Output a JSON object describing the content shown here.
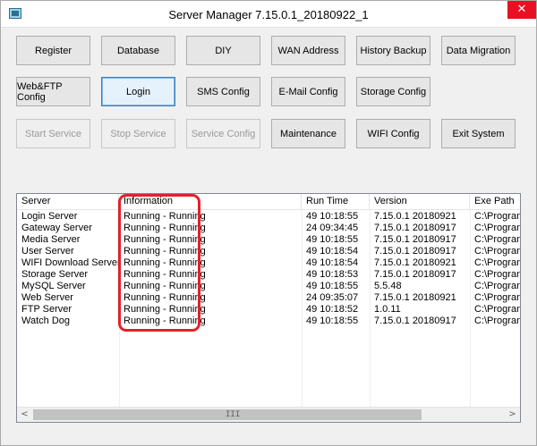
{
  "window": {
    "title": "Server Manager 7.15.0.1_20180922_1",
    "close_glyph": "✕",
    "icon": "app-icon"
  },
  "buttons": {
    "row1": [
      "Register",
      "Database",
      "DIY",
      "WAN Address",
      "History Backup",
      "Data Migration"
    ],
    "row2": [
      "Web&FTP Config",
      "Login",
      "SMS Config",
      "E-Mail Config",
      "Storage Config"
    ],
    "row3": [
      "Start Service",
      "Stop Service",
      "Service Config",
      "Maintenance",
      "WIFI Config",
      "Exit System"
    ],
    "disabled": [
      "Start Service",
      "Stop Service",
      "Service Config"
    ]
  },
  "table": {
    "columns": [
      "Server",
      "Information",
      "Run Time",
      "Version",
      "Exe Path"
    ],
    "rows": [
      [
        "Login Server",
        "Running - Running",
        "49 10:18:55",
        "7.15.0.1 20180921",
        "C:\\Progran"
      ],
      [
        "Gateway Server",
        "Running - Running",
        "24 09:34:45",
        "7.15.0.1 20180917",
        "C:\\Progran"
      ],
      [
        "Media Server",
        "Running - Running",
        "49 10:18:55",
        "7.15.0.1 20180917",
        "C:\\Progran"
      ],
      [
        "User Server",
        "Running - Running",
        "49 10:18:54",
        "7.15.0.1 20180917",
        "C:\\Progran"
      ],
      [
        "WIFI Download Server",
        "Running - Running",
        "49 10:18:54",
        "7.15.0.1 20180921",
        "C:\\Progran"
      ],
      [
        "Storage Server",
        "Running - Running",
        "49 10:18:53",
        "7.15.0.1 20180917",
        "C:\\Progran"
      ],
      [
        "MySQL Server",
        "Running - Running",
        "49 10:18:55",
        "5.5.48",
        "C:\\Progran"
      ],
      [
        "Web Server",
        "Running - Running",
        "24 09:35:07",
        "7.15.0.1  20180921",
        "C:\\Progran"
      ],
      [
        "FTP Server",
        "Running - Running",
        "49 10:18:52",
        "1.0.11",
        "C:\\Progran"
      ],
      [
        "Watch Dog",
        "Running - Running",
        "49 10:18:55",
        "7.15.0.1 20180917",
        "C:\\Progran"
      ]
    ]
  },
  "scrollbar": {
    "left_arrow": "<",
    "right_arrow": ">",
    "grip": "III"
  },
  "colors": {
    "highlight": "#e3202a",
    "close": "#e81123"
  }
}
